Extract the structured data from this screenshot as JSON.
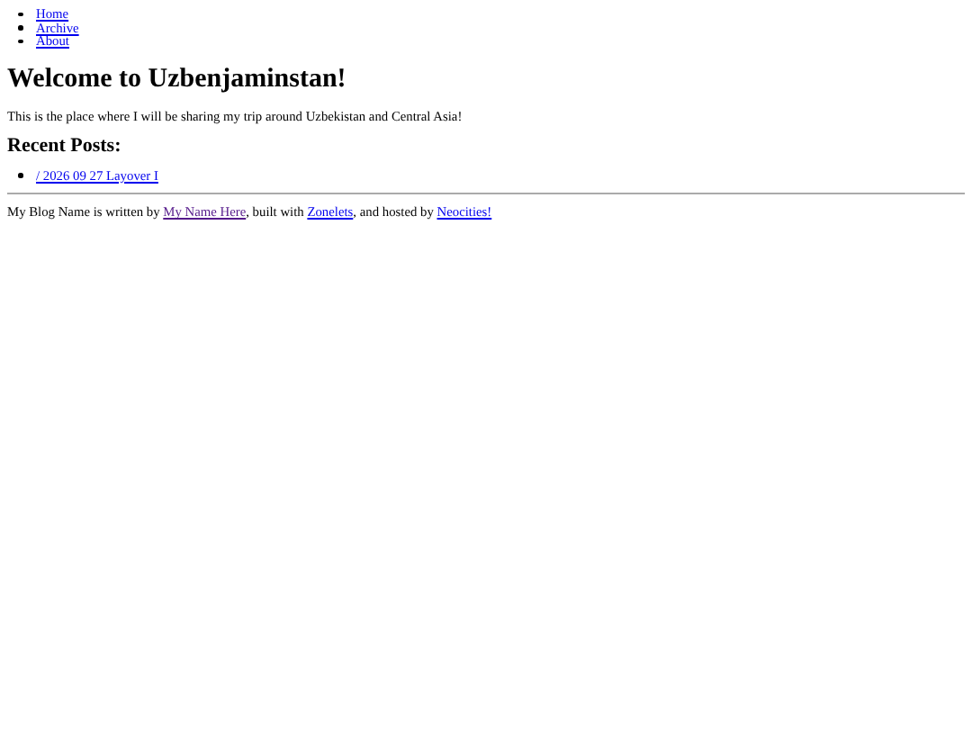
{
  "nav": [
    {
      "label": "Home"
    },
    {
      "label": "Archive"
    },
    {
      "label": "About"
    }
  ],
  "heading": "Welcome to Uzbenjaminstan!",
  "intro": "This is the place where I will be sharing my trip around Uzbekistan and Central Asia!",
  "recent_posts": {
    "heading": "Recent Posts:",
    "items": [
      {
        "label": "/ 2026 09 27 Layover I"
      }
    ]
  },
  "footer": [
    {
      "kind": "text",
      "text": "My Blog Name is written by "
    },
    {
      "kind": "link",
      "text": "My Name Here",
      "visited": true
    },
    {
      "kind": "text",
      "text": ", built with "
    },
    {
      "kind": "link",
      "text": "Zonelets",
      "visited": false
    },
    {
      "kind": "text",
      "text": ", and hosted by "
    },
    {
      "kind": "link",
      "text": "Neocities!",
      "visited": false
    }
  ]
}
